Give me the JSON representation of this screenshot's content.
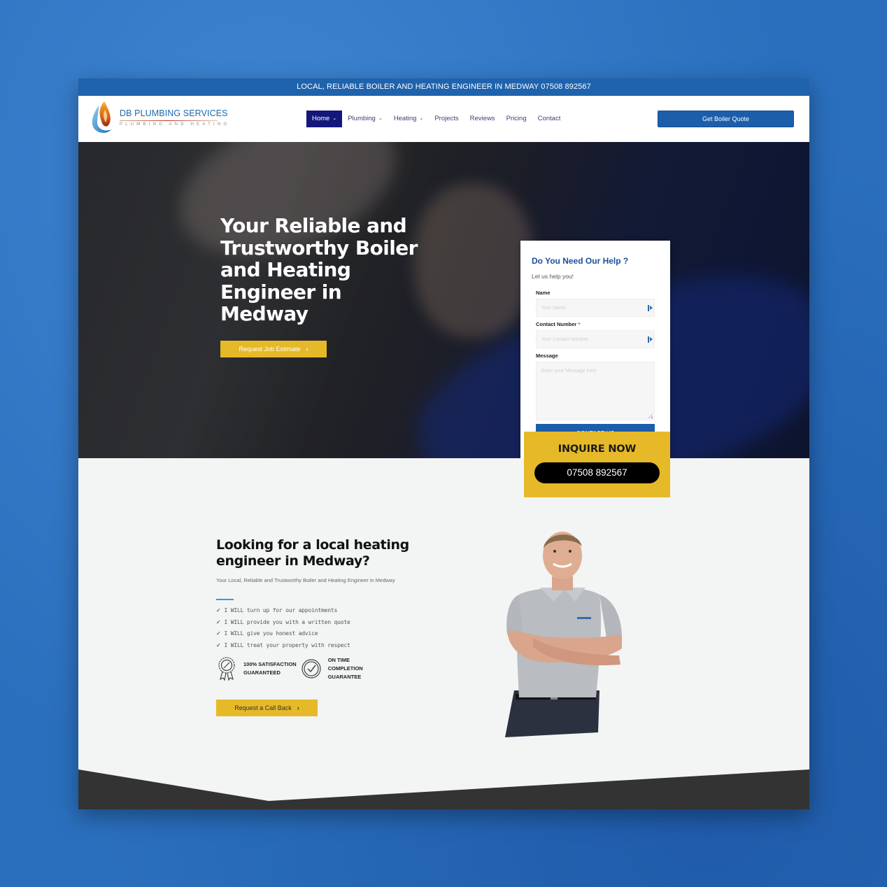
{
  "topbar": {
    "text": "LOCAL, RELIABLE BOILER AND HEATING ENGINEER IN MEDWAY 07508 892567"
  },
  "brand": {
    "name": "DB PLUMBING SERVICES",
    "tagline": "PLUMBING AND HEATING",
    "logo_icon": "flame-droplet-icon"
  },
  "nav": {
    "items": [
      {
        "label": "Home",
        "has_dropdown": true,
        "active": true
      },
      {
        "label": "Plumbing",
        "has_dropdown": true,
        "active": false
      },
      {
        "label": "Heating",
        "has_dropdown": true,
        "active": false
      },
      {
        "label": "Projects",
        "has_dropdown": false,
        "active": false
      },
      {
        "label": "Reviews",
        "has_dropdown": false,
        "active": false
      },
      {
        "label": "Pricing",
        "has_dropdown": false,
        "active": false
      },
      {
        "label": "Contact",
        "has_dropdown": false,
        "active": false
      }
    ],
    "cta_label": "Get Boiler Quote",
    "dropdown_glyph": "⌄"
  },
  "hero": {
    "title": "Your Reliable and Trustworthy Boiler and Heating Engineer in Medway",
    "button_label": "Request Job Estimate",
    "chevron": "›"
  },
  "form": {
    "title": "Do You Need Our Help ?",
    "subtitle": "Let us help you!",
    "fields": {
      "name": {
        "label": "Name",
        "placeholder": "Your Name",
        "value": ""
      },
      "contact": {
        "label": "Contact Number",
        "required_mark": "*",
        "placeholder": "Your Contact Number",
        "value": ""
      },
      "message": {
        "label": "Message",
        "placeholder": "Enter your Message here",
        "value": ""
      }
    },
    "submit_label": "CONTACT US"
  },
  "inquire": {
    "title": "INQUIRE NOW",
    "phone": "07508 892567"
  },
  "about": {
    "title": "Looking for a local heating engineer in Medway?",
    "subtitle": "Your Local, Reliable and Trustworthy Boiler and Heating Engineer in Medway",
    "check_glyph": "✓",
    "checklist": [
      "I WILL turn up for our appointments",
      "I WILL provide you with a written quote",
      "I WILL give you honest advice",
      "I WILL treat your property with respect"
    ],
    "badges": [
      {
        "icon": "award-rosette-icon",
        "text_lines": [
          "100% SATISFACTION",
          "GUARANTEED"
        ]
      },
      {
        "icon": "check-circle-icon",
        "text_lines": [
          "ON TIME",
          "COMPLETION",
          "GUARANTEE"
        ]
      }
    ],
    "callback_label": "Request a Call Back",
    "chevron": "›"
  },
  "colors": {
    "primary_blue": "#1d5eaa",
    "nav_active": "#14177a",
    "accent_yellow": "#e6b928",
    "footer_dark": "#333333"
  }
}
